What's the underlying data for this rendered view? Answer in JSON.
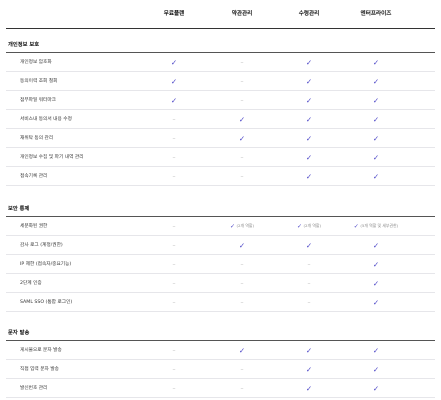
{
  "columns": [
    "무료플랜",
    "약관관리",
    "수령관리",
    "엔터프라이즈"
  ],
  "symbols": {
    "check": "✓",
    "dash": "–"
  },
  "accent_color": "#4a44c6",
  "sections": [
    {
      "title": "개인정보 보호",
      "rows": [
        {
          "label": "개인정보 암호화",
          "cells": [
            {
              "v": "check"
            },
            {
              "v": "dash"
            },
            {
              "v": "check"
            },
            {
              "v": "check"
            }
          ]
        },
        {
          "label": "동의이력 조회 철회",
          "cells": [
            {
              "v": "check"
            },
            {
              "v": "dash"
            },
            {
              "v": "check"
            },
            {
              "v": "check"
            }
          ]
        },
        {
          "label": "점부파일 워터마크",
          "cells": [
            {
              "v": "check"
            },
            {
              "v": "dash"
            },
            {
              "v": "check"
            },
            {
              "v": "check"
            }
          ]
        },
        {
          "label": "서비스내 동의서 내용 수정",
          "cells": [
            {
              "v": "dash"
            },
            {
              "v": "check"
            },
            {
              "v": "check"
            },
            {
              "v": "check"
            }
          ]
        },
        {
          "label": "재위탁 동의 관리",
          "cells": [
            {
              "v": "dash"
            },
            {
              "v": "check"
            },
            {
              "v": "check"
            },
            {
              "v": "check"
            }
          ]
        },
        {
          "label": "개인정보 수집 및 파기 내역 관리",
          "cells": [
            {
              "v": "dash"
            },
            {
              "v": "dash"
            },
            {
              "v": "check"
            },
            {
              "v": "check"
            }
          ]
        },
        {
          "label": "접속기록 관리",
          "cells": [
            {
              "v": "dash"
            },
            {
              "v": "dash"
            },
            {
              "v": "check"
            },
            {
              "v": "check"
            }
          ]
        }
      ]
    },
    {
      "title": "보안 통제",
      "rows": [
        {
          "label": "세분화된 권한",
          "cells": [
            {
              "v": "dash"
            },
            {
              "v": "check",
              "note": "(2개 역할)"
            },
            {
              "v": "check",
              "note": "(2개 역할)"
            },
            {
              "v": "check",
              "note": "(5개 역할 및 세부권한)"
            }
          ]
        },
        {
          "label": "감사 로그 (계정/권한)",
          "cells": [
            {
              "v": "dash"
            },
            {
              "v": "check"
            },
            {
              "v": "check"
            },
            {
              "v": "check"
            }
          ]
        },
        {
          "label": "IP 제한 (접속자/중요기능)",
          "cells": [
            {
              "v": "dash"
            },
            {
              "v": "dash"
            },
            {
              "v": "dash"
            },
            {
              "v": "check"
            }
          ]
        },
        {
          "label": "2단계 인증",
          "cells": [
            {
              "v": "dash"
            },
            {
              "v": "dash"
            },
            {
              "v": "dash"
            },
            {
              "v": "check"
            }
          ]
        },
        {
          "label": "SAML SSO (통합 로그인)",
          "cells": [
            {
              "v": "dash"
            },
            {
              "v": "dash"
            },
            {
              "v": "dash"
            },
            {
              "v": "check"
            }
          ]
        }
      ]
    },
    {
      "title": "문자 발송",
      "rows": [
        {
          "label": "게시물으로 문자 발송",
          "cells": [
            {
              "v": "dash"
            },
            {
              "v": "check"
            },
            {
              "v": "check"
            },
            {
              "v": "check"
            }
          ]
        },
        {
          "label": "직접 입력 문자 발송",
          "cells": [
            {
              "v": "dash"
            },
            {
              "v": "dash"
            },
            {
              "v": "check"
            },
            {
              "v": "check"
            }
          ]
        },
        {
          "label": "발신번호 관리",
          "cells": [
            {
              "v": "dash"
            },
            {
              "v": "dash"
            },
            {
              "v": "check"
            },
            {
              "v": "check"
            }
          ]
        }
      ]
    }
  ]
}
